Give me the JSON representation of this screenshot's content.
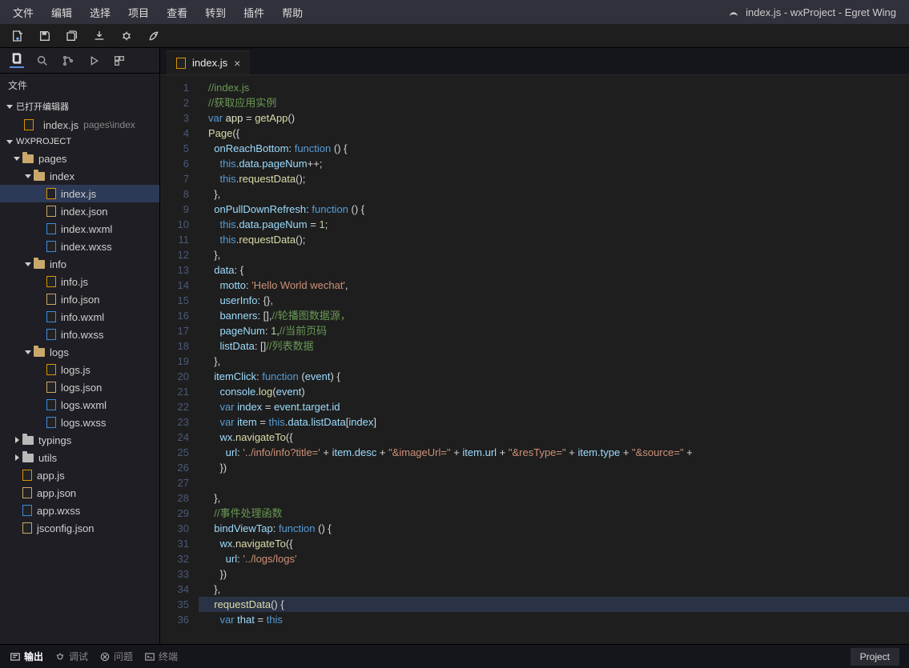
{
  "window_title": "index.js - wxProject - Egret Wing",
  "menus": [
    "文件",
    "编辑",
    "选择",
    "项目",
    "查看",
    "转到",
    "插件",
    "帮助"
  ],
  "sidebar": {
    "header": "文件",
    "open_editors_label": "已打开编辑器",
    "open_editor": {
      "name": "index.js",
      "path": "pages\\index"
    },
    "project_label": "WXPROJECT",
    "tree": [
      {
        "kind": "folder",
        "name": "pages",
        "level": 0,
        "open": true,
        "caret": "down"
      },
      {
        "kind": "folder",
        "name": "index",
        "level": 1,
        "open": true,
        "caret": "down"
      },
      {
        "kind": "file",
        "name": "index.js",
        "level": 2,
        "ftype": "js",
        "selected": true
      },
      {
        "kind": "file",
        "name": "index.json",
        "level": 2,
        "ftype": "json"
      },
      {
        "kind": "file",
        "name": "index.wxml",
        "level": 2,
        "ftype": "wxml"
      },
      {
        "kind": "file",
        "name": "index.wxss",
        "level": 2,
        "ftype": "wxss"
      },
      {
        "kind": "folder",
        "name": "info",
        "level": 1,
        "open": true,
        "caret": "down"
      },
      {
        "kind": "file",
        "name": "info.js",
        "level": 2,
        "ftype": "js"
      },
      {
        "kind": "file",
        "name": "info.json",
        "level": 2,
        "ftype": "json"
      },
      {
        "kind": "file",
        "name": "info.wxml",
        "level": 2,
        "ftype": "wxml"
      },
      {
        "kind": "file",
        "name": "info.wxss",
        "level": 2,
        "ftype": "wxss"
      },
      {
        "kind": "folder",
        "name": "logs",
        "level": 1,
        "open": true,
        "caret": "down"
      },
      {
        "kind": "file",
        "name": "logs.js",
        "level": 2,
        "ftype": "js"
      },
      {
        "kind": "file",
        "name": "logs.json",
        "level": 2,
        "ftype": "json"
      },
      {
        "kind": "file",
        "name": "logs.wxml",
        "level": 2,
        "ftype": "wxml"
      },
      {
        "kind": "file",
        "name": "logs.wxss",
        "level": 2,
        "ftype": "wxss"
      },
      {
        "kind": "folder",
        "name": "typings",
        "level": 0,
        "open": false,
        "caret": "right"
      },
      {
        "kind": "folder",
        "name": "utils",
        "level": 0,
        "open": false,
        "caret": "right"
      },
      {
        "kind": "file",
        "name": "app.js",
        "level": 0,
        "ftype": "js"
      },
      {
        "kind": "file",
        "name": "app.json",
        "level": 0,
        "ftype": "json"
      },
      {
        "kind": "file",
        "name": "app.wxss",
        "level": 0,
        "ftype": "wxss"
      },
      {
        "kind": "file",
        "name": "jsconfig.json",
        "level": 0,
        "ftype": "json"
      }
    ]
  },
  "editor": {
    "tab_label": "index.js",
    "code": [
      {
        "n": 1,
        "h": [
          [
            "c-comment",
            "//index.js"
          ]
        ]
      },
      {
        "n": 2,
        "h": [
          [
            "c-comment",
            "//获取应用实例"
          ]
        ]
      },
      {
        "n": 3,
        "h": [
          [
            "c-key",
            "var"
          ],
          [
            "c-plain",
            " app "
          ],
          [
            "c-op",
            "="
          ],
          [
            "c-plain",
            " "
          ],
          [
            "c-func",
            "getApp"
          ],
          [
            "c-op",
            "()"
          ]
        ]
      },
      {
        "n": 4,
        "h": [
          [
            "c-func",
            "Page"
          ],
          [
            "c-op",
            "({"
          ]
        ]
      },
      {
        "n": 5,
        "h": [
          [
            "c-plain",
            "  "
          ],
          [
            "c-prop",
            "onReachBottom"
          ],
          [
            "c-op",
            ": "
          ],
          [
            "c-key",
            "function"
          ],
          [
            "c-op",
            " () {"
          ]
        ]
      },
      {
        "n": 6,
        "h": [
          [
            "c-plain",
            "    "
          ],
          [
            "c-this",
            "this"
          ],
          [
            "c-op",
            "."
          ],
          [
            "c-prop",
            "data"
          ],
          [
            "c-op",
            "."
          ],
          [
            "c-prop",
            "pageNum"
          ],
          [
            "c-op",
            "++;"
          ]
        ]
      },
      {
        "n": 7,
        "h": [
          [
            "c-plain",
            "    "
          ],
          [
            "c-this",
            "this"
          ],
          [
            "c-op",
            "."
          ],
          [
            "c-func",
            "requestData"
          ],
          [
            "c-op",
            "();"
          ]
        ]
      },
      {
        "n": 8,
        "h": [
          [
            "c-plain",
            "  "
          ],
          [
            "c-op",
            "},"
          ]
        ]
      },
      {
        "n": 9,
        "h": [
          [
            "c-plain",
            "  "
          ],
          [
            "c-prop",
            "onPullDownRefresh"
          ],
          [
            "c-op",
            ": "
          ],
          [
            "c-key",
            "function"
          ],
          [
            "c-op",
            " () {"
          ]
        ]
      },
      {
        "n": 10,
        "h": [
          [
            "c-plain",
            "    "
          ],
          [
            "c-this",
            "this"
          ],
          [
            "c-op",
            "."
          ],
          [
            "c-prop",
            "data"
          ],
          [
            "c-op",
            "."
          ],
          [
            "c-prop",
            "pageNum"
          ],
          [
            "c-op",
            " = "
          ],
          [
            "c-num",
            "1"
          ],
          [
            "c-op",
            ";"
          ]
        ]
      },
      {
        "n": 11,
        "h": [
          [
            "c-plain",
            "    "
          ],
          [
            "c-this",
            "this"
          ],
          [
            "c-op",
            "."
          ],
          [
            "c-func",
            "requestData"
          ],
          [
            "c-op",
            "();"
          ]
        ]
      },
      {
        "n": 12,
        "h": [
          [
            "c-plain",
            "  "
          ],
          [
            "c-op",
            "},"
          ]
        ]
      },
      {
        "n": 13,
        "h": [
          [
            "c-plain",
            "  "
          ],
          [
            "c-prop",
            "data"
          ],
          [
            "c-op",
            ": {"
          ]
        ]
      },
      {
        "n": 14,
        "h": [
          [
            "c-plain",
            "    "
          ],
          [
            "c-prop",
            "motto"
          ],
          [
            "c-op",
            ": "
          ],
          [
            "c-str",
            "'Hello World wechat'"
          ],
          [
            "c-op",
            ","
          ]
        ]
      },
      {
        "n": 15,
        "h": [
          [
            "c-plain",
            "    "
          ],
          [
            "c-prop",
            "userInfo"
          ],
          [
            "c-op",
            ": {},"
          ]
        ]
      },
      {
        "n": 16,
        "h": [
          [
            "c-plain",
            "    "
          ],
          [
            "c-prop",
            "banners"
          ],
          [
            "c-op",
            ": [],"
          ],
          [
            "c-comment",
            "//轮播图数据源，"
          ]
        ]
      },
      {
        "n": 17,
        "h": [
          [
            "c-plain",
            "    "
          ],
          [
            "c-prop",
            "pageNum"
          ],
          [
            "c-op",
            ": "
          ],
          [
            "c-num",
            "1"
          ],
          [
            "c-op",
            ","
          ],
          [
            "c-comment",
            "//当前页码"
          ]
        ]
      },
      {
        "n": 18,
        "h": [
          [
            "c-plain",
            "    "
          ],
          [
            "c-prop",
            "listData"
          ],
          [
            "c-op",
            ": []"
          ],
          [
            "c-comment",
            "//列表数据"
          ]
        ]
      },
      {
        "n": 19,
        "h": [
          [
            "c-plain",
            "  "
          ],
          [
            "c-op",
            "},"
          ]
        ]
      },
      {
        "n": 20,
        "h": [
          [
            "c-plain",
            "  "
          ],
          [
            "c-prop",
            "itemClick"
          ],
          [
            "c-op",
            ": "
          ],
          [
            "c-key",
            "function"
          ],
          [
            "c-op",
            " ("
          ],
          [
            "c-prop",
            "event"
          ],
          [
            "c-op",
            ") {"
          ]
        ]
      },
      {
        "n": 21,
        "h": [
          [
            "c-plain",
            "    "
          ],
          [
            "c-prop",
            "console"
          ],
          [
            "c-op",
            "."
          ],
          [
            "c-func",
            "log"
          ],
          [
            "c-op",
            "("
          ],
          [
            "c-prop",
            "event"
          ],
          [
            "c-op",
            ")"
          ]
        ]
      },
      {
        "n": 22,
        "h": [
          [
            "c-plain",
            "    "
          ],
          [
            "c-key",
            "var"
          ],
          [
            "c-plain",
            " "
          ],
          [
            "c-prop",
            "index"
          ],
          [
            "c-op",
            " = "
          ],
          [
            "c-prop",
            "event"
          ],
          [
            "c-op",
            "."
          ],
          [
            "c-prop",
            "target"
          ],
          [
            "c-op",
            "."
          ],
          [
            "c-prop",
            "id"
          ]
        ]
      },
      {
        "n": 23,
        "h": [
          [
            "c-plain",
            "    "
          ],
          [
            "c-key",
            "var"
          ],
          [
            "c-plain",
            " "
          ],
          [
            "c-prop",
            "item"
          ],
          [
            "c-op",
            " = "
          ],
          [
            "c-this",
            "this"
          ],
          [
            "c-op",
            "."
          ],
          [
            "c-prop",
            "data"
          ],
          [
            "c-op",
            "."
          ],
          [
            "c-prop",
            "listData"
          ],
          [
            "c-op",
            "["
          ],
          [
            "c-prop",
            "index"
          ],
          [
            "c-op",
            "]"
          ]
        ]
      },
      {
        "n": 24,
        "h": [
          [
            "c-plain",
            "    "
          ],
          [
            "c-prop",
            "wx"
          ],
          [
            "c-op",
            "."
          ],
          [
            "c-func",
            "navigateTo"
          ],
          [
            "c-op",
            "({"
          ]
        ]
      },
      {
        "n": 25,
        "h": [
          [
            "c-plain",
            "      "
          ],
          [
            "c-prop",
            "url"
          ],
          [
            "c-op",
            ": "
          ],
          [
            "c-str",
            "'../info/info?title='"
          ],
          [
            "c-op",
            " + "
          ],
          [
            "c-prop",
            "item"
          ],
          [
            "c-op",
            "."
          ],
          [
            "c-prop",
            "desc"
          ],
          [
            "c-op",
            " + "
          ],
          [
            "c-str",
            "\"&imageUrl=\""
          ],
          [
            "c-op",
            " + "
          ],
          [
            "c-prop",
            "item"
          ],
          [
            "c-op",
            "."
          ],
          [
            "c-prop",
            "url"
          ],
          [
            "c-op",
            " + "
          ],
          [
            "c-str",
            "\"&resType=\""
          ],
          [
            "c-op",
            " + "
          ],
          [
            "c-prop",
            "item"
          ],
          [
            "c-op",
            "."
          ],
          [
            "c-prop",
            "type"
          ],
          [
            "c-op",
            " + "
          ],
          [
            "c-str",
            "\"&source=\""
          ],
          [
            "c-op",
            " + "
          ]
        ]
      },
      {
        "n": 26,
        "h": [
          [
            "c-plain",
            "    "
          ],
          [
            "c-op",
            "})"
          ]
        ]
      },
      {
        "n": 27,
        "h": [
          [
            "c-plain",
            " "
          ]
        ]
      },
      {
        "n": 28,
        "h": [
          [
            "c-plain",
            "  "
          ],
          [
            "c-op",
            "},"
          ]
        ]
      },
      {
        "n": 29,
        "h": [
          [
            "c-plain",
            "  "
          ],
          [
            "c-comment",
            "//事件处理函数"
          ]
        ]
      },
      {
        "n": 30,
        "h": [
          [
            "c-plain",
            "  "
          ],
          [
            "c-prop",
            "bindViewTap"
          ],
          [
            "c-op",
            ": "
          ],
          [
            "c-key",
            "function"
          ],
          [
            "c-op",
            " () {"
          ]
        ]
      },
      {
        "n": 31,
        "h": [
          [
            "c-plain",
            "    "
          ],
          [
            "c-prop",
            "wx"
          ],
          [
            "c-op",
            "."
          ],
          [
            "c-func",
            "navigateTo"
          ],
          [
            "c-op",
            "({"
          ]
        ]
      },
      {
        "n": 32,
        "h": [
          [
            "c-plain",
            "      "
          ],
          [
            "c-prop",
            "url"
          ],
          [
            "c-op",
            ": "
          ],
          [
            "c-str",
            "'../logs/logs'"
          ]
        ]
      },
      {
        "n": 33,
        "h": [
          [
            "c-plain",
            "    "
          ],
          [
            "c-op",
            "})"
          ]
        ]
      },
      {
        "n": 34,
        "h": [
          [
            "c-plain",
            "  "
          ],
          [
            "c-op",
            "},"
          ]
        ]
      },
      {
        "n": 35,
        "hl": true,
        "h": [
          [
            "c-plain",
            "  "
          ],
          [
            "c-func",
            "requestData"
          ],
          [
            "c-op",
            "() {"
          ]
        ]
      },
      {
        "n": 36,
        "h": [
          [
            "c-plain",
            "    "
          ],
          [
            "c-key",
            "var"
          ],
          [
            "c-plain",
            " "
          ],
          [
            "c-prop",
            "that"
          ],
          [
            "c-op",
            " = "
          ],
          [
            "c-this",
            "this"
          ]
        ]
      }
    ]
  },
  "status": {
    "output": "输出",
    "debug": "调试",
    "problems": "问题",
    "terminal": "终端",
    "project": "Project"
  }
}
